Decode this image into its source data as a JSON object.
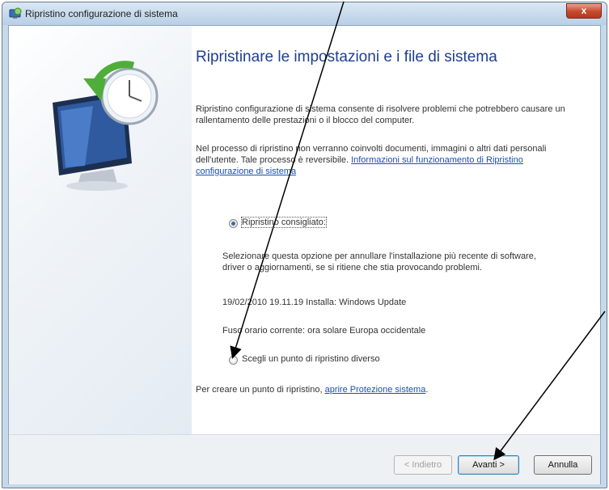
{
  "window": {
    "title": "Ripristino configurazione di sistema",
    "close_symbol": "x"
  },
  "main": {
    "heading": "Ripristinare le impostazioni e i file di sistema",
    "paragraph1": "Ripristino configurazione di sistema consente di risolvere problemi che potrebbero causare un rallentamento delle prestazioni o il blocco del computer.",
    "paragraph2_text": "Nel processo di ripristino non verranno coinvolti documenti, immagini o altri dati personali dell'utente. Tale processo è reversibile.",
    "paragraph2_link": "Informazioni sul funzionamento di Ripristino configurazione di sistema",
    "option_recommended": {
      "label": "Ripristino consigliato:",
      "selected": true,
      "description": "Selezionare questa opzione per annullare l'installazione più recente di software, driver o aggiornamenti, se si ritiene che stia provocando problemi.",
      "restore_point": "19/02/2010 19.11.19 Installa: Windows Update",
      "timezone": "Fuso orario corrente: ora solare Europa occidentale"
    },
    "option_other": {
      "label": "Scegli un punto di ripristino diverso",
      "selected": false
    },
    "create_point_text": "Per creare un punto di ripristino,",
    "create_point_link": "aprire Protezione sistema",
    "create_point_end": "."
  },
  "footer": {
    "back_label": "< Indietro",
    "next_label": "Avanti >",
    "cancel_label": "Annulla"
  },
  "colors": {
    "heading": "#1e3f8f",
    "link": "#1a4fb3",
    "close_button": "#c6482c"
  }
}
